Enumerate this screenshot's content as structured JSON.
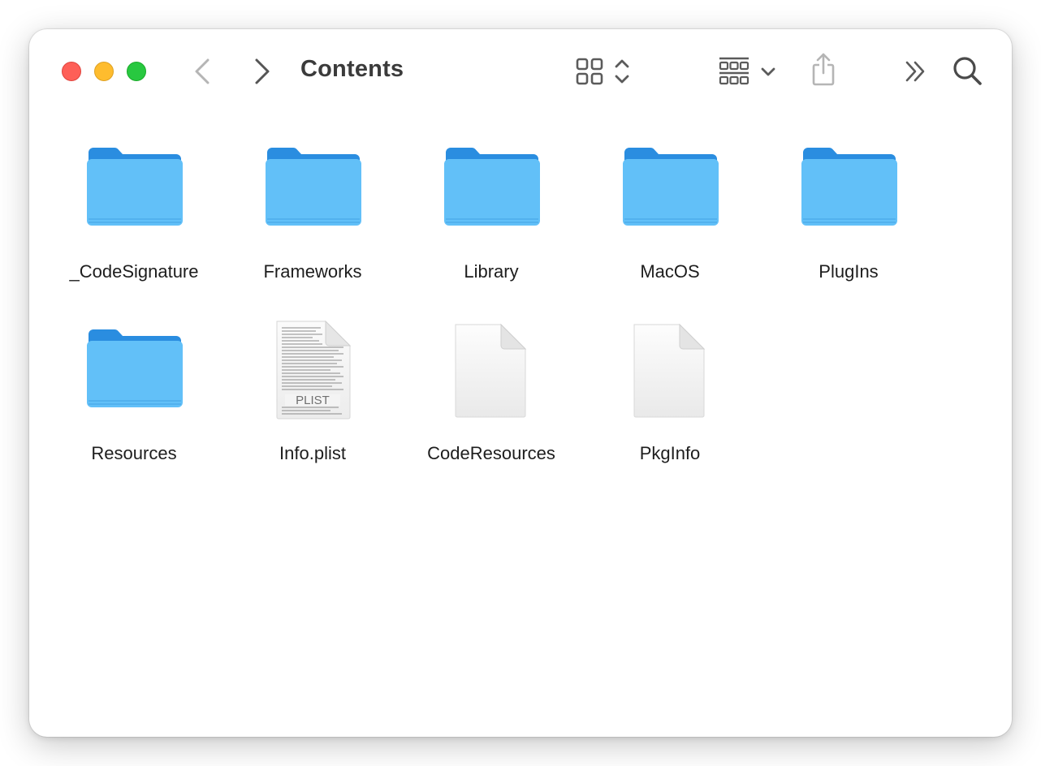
{
  "window": {
    "title": "Contents"
  },
  "toolbar": {
    "back_icon": "chevron-left-icon",
    "forward_icon": "chevron-right-icon",
    "view_icon": "icon-grid-view-icon",
    "group_icon": "group-by-icon",
    "share_icon": "share-icon",
    "more_icon": "double-chevron-right-icon",
    "search_icon": "search-icon"
  },
  "colors": {
    "folder_top": "#2a8de0",
    "folder_front": "#62c0f8",
    "close": "#fe5f57",
    "minimize": "#febc2e",
    "zoom": "#28c840"
  },
  "items": [
    {
      "name": "_CodeSignature",
      "kind": "folder"
    },
    {
      "name": "Frameworks",
      "kind": "folder"
    },
    {
      "name": "Library",
      "kind": "folder"
    },
    {
      "name": "MacOS",
      "kind": "folder"
    },
    {
      "name": "PlugIns",
      "kind": "folder"
    },
    {
      "name": "Resources",
      "kind": "folder"
    },
    {
      "name": "Info.plist",
      "kind": "plist",
      "badge": "PLIST"
    },
    {
      "name": "CodeResources",
      "kind": "document"
    },
    {
      "name": "PkgInfo",
      "kind": "document"
    }
  ]
}
